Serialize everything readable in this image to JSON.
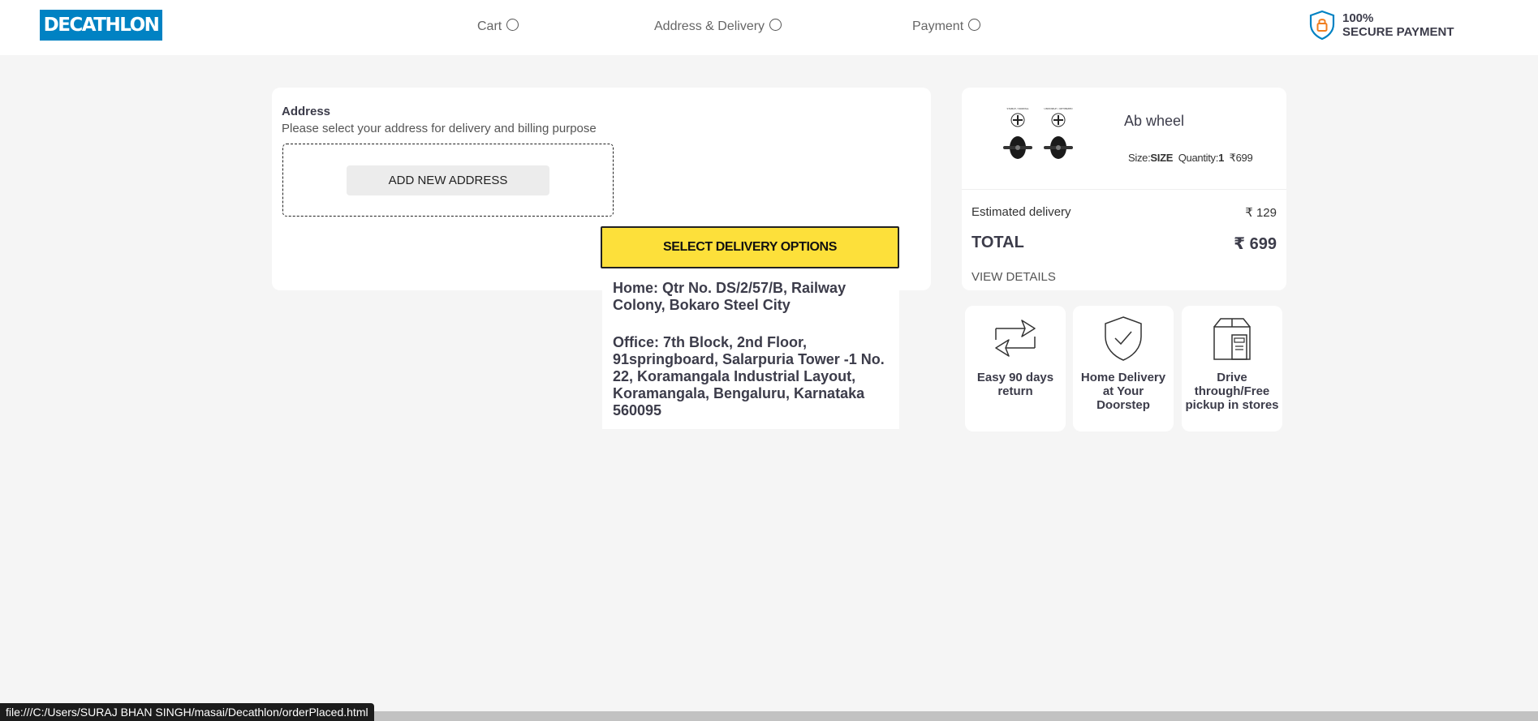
{
  "header": {
    "logo_text": "DECATHLON",
    "steps": [
      {
        "label": "Cart"
      },
      {
        "label": "Address & Delivery"
      },
      {
        "label": "Payment"
      }
    ],
    "secure_line1": "100%",
    "secure_line2": "SECURE PAYMENT"
  },
  "address": {
    "title": "Address",
    "subtitle": "Please select your address for delivery and billing purpose",
    "add_button": "ADD NEW ADDRESS",
    "delivery_button": "SELECT DELIVERY OPTIONS",
    "options": [
      "Home: Qtr No. DS/2/57/B, Railway Colony, Bokaro Steel City",
      "Office: 7th Block, 2nd Floor, 91springboard, Salarpuria Tower -1 No. 22, Koramangala Industrial Layout, Koramangala, Bengaluru, Karnataka 560095"
    ]
  },
  "summary": {
    "product_name": "Ab wheel",
    "size_label": "Size:",
    "size_value": "SIZE",
    "qty_label": "Quantity:",
    "qty_value": "1",
    "price": "₹699",
    "img_label_left": "STABLE / NORMAL",
    "img_label_right": "UNSTABLE / OPTIMIZED",
    "est_label": "Estimated delivery",
    "est_value": "₹ 129",
    "total_label": "TOTAL",
    "total_value": "₹ 699",
    "view_details": "VIEW DETAILS"
  },
  "features": [
    {
      "text": "Easy 90 days return",
      "icon": "return-arrows-icon"
    },
    {
      "text": "Home Delivery at Your Doorstep",
      "icon": "shield-check-icon"
    },
    {
      "text": "Drive through/Free pickup in stores",
      "icon": "store-box-icon"
    }
  ],
  "status_bar": {
    "url": "file:///C:/Users/SURAJ BHAN SINGH/masai/Decathlon/orderPlaced.html"
  },
  "colors": {
    "brand_blue": "#0082c3",
    "button_yellow": "#fde03a",
    "background": "#f5f5f5",
    "lock_orange": "#f07d1e"
  }
}
